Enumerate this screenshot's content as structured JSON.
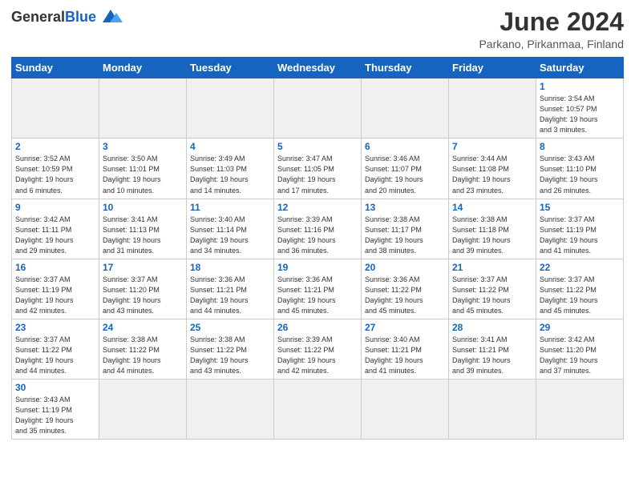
{
  "header": {
    "logo_general": "General",
    "logo_blue": "Blue",
    "month_title": "June 2024",
    "location": "Parkano, Pirkanmaa, Finland"
  },
  "weekdays": [
    "Sunday",
    "Monday",
    "Tuesday",
    "Wednesday",
    "Thursday",
    "Friday",
    "Saturday"
  ],
  "days": [
    {
      "date": "",
      "info": ""
    },
    {
      "date": "",
      "info": ""
    },
    {
      "date": "",
      "info": ""
    },
    {
      "date": "",
      "info": ""
    },
    {
      "date": "",
      "info": ""
    },
    {
      "date": "",
      "info": ""
    },
    {
      "date": "1",
      "info": "Sunrise: 3:54 AM\nSunset: 10:57 PM\nDaylight: 19 hours\nand 3 minutes."
    },
    {
      "date": "2",
      "info": "Sunrise: 3:52 AM\nSunset: 10:59 PM\nDaylight: 19 hours\nand 6 minutes."
    },
    {
      "date": "3",
      "info": "Sunrise: 3:50 AM\nSunset: 11:01 PM\nDaylight: 19 hours\nand 10 minutes."
    },
    {
      "date": "4",
      "info": "Sunrise: 3:49 AM\nSunset: 11:03 PM\nDaylight: 19 hours\nand 14 minutes."
    },
    {
      "date": "5",
      "info": "Sunrise: 3:47 AM\nSunset: 11:05 PM\nDaylight: 19 hours\nand 17 minutes."
    },
    {
      "date": "6",
      "info": "Sunrise: 3:46 AM\nSunset: 11:07 PM\nDaylight: 19 hours\nand 20 minutes."
    },
    {
      "date": "7",
      "info": "Sunrise: 3:44 AM\nSunset: 11:08 PM\nDaylight: 19 hours\nand 23 minutes."
    },
    {
      "date": "8",
      "info": "Sunrise: 3:43 AM\nSunset: 11:10 PM\nDaylight: 19 hours\nand 26 minutes."
    },
    {
      "date": "9",
      "info": "Sunrise: 3:42 AM\nSunset: 11:11 PM\nDaylight: 19 hours\nand 29 minutes."
    },
    {
      "date": "10",
      "info": "Sunrise: 3:41 AM\nSunset: 11:13 PM\nDaylight: 19 hours\nand 31 minutes."
    },
    {
      "date": "11",
      "info": "Sunrise: 3:40 AM\nSunset: 11:14 PM\nDaylight: 19 hours\nand 34 minutes."
    },
    {
      "date": "12",
      "info": "Sunrise: 3:39 AM\nSunset: 11:16 PM\nDaylight: 19 hours\nand 36 minutes."
    },
    {
      "date": "13",
      "info": "Sunrise: 3:38 AM\nSunset: 11:17 PM\nDaylight: 19 hours\nand 38 minutes."
    },
    {
      "date": "14",
      "info": "Sunrise: 3:38 AM\nSunset: 11:18 PM\nDaylight: 19 hours\nand 39 minutes."
    },
    {
      "date": "15",
      "info": "Sunrise: 3:37 AM\nSunset: 11:19 PM\nDaylight: 19 hours\nand 41 minutes."
    },
    {
      "date": "16",
      "info": "Sunrise: 3:37 AM\nSunset: 11:19 PM\nDaylight: 19 hours\nand 42 minutes."
    },
    {
      "date": "17",
      "info": "Sunrise: 3:37 AM\nSunset: 11:20 PM\nDaylight: 19 hours\nand 43 minutes."
    },
    {
      "date": "18",
      "info": "Sunrise: 3:36 AM\nSunset: 11:21 PM\nDaylight: 19 hours\nand 44 minutes."
    },
    {
      "date": "19",
      "info": "Sunrise: 3:36 AM\nSunset: 11:21 PM\nDaylight: 19 hours\nand 45 minutes."
    },
    {
      "date": "20",
      "info": "Sunrise: 3:36 AM\nSunset: 11:22 PM\nDaylight: 19 hours\nand 45 minutes."
    },
    {
      "date": "21",
      "info": "Sunrise: 3:37 AM\nSunset: 11:22 PM\nDaylight: 19 hours\nand 45 minutes."
    },
    {
      "date": "22",
      "info": "Sunrise: 3:37 AM\nSunset: 11:22 PM\nDaylight: 19 hours\nand 45 minutes."
    },
    {
      "date": "23",
      "info": "Sunrise: 3:37 AM\nSunset: 11:22 PM\nDaylight: 19 hours\nand 44 minutes."
    },
    {
      "date": "24",
      "info": "Sunrise: 3:38 AM\nSunset: 11:22 PM\nDaylight: 19 hours\nand 44 minutes."
    },
    {
      "date": "25",
      "info": "Sunrise: 3:38 AM\nSunset: 11:22 PM\nDaylight: 19 hours\nand 43 minutes."
    },
    {
      "date": "26",
      "info": "Sunrise: 3:39 AM\nSunset: 11:22 PM\nDaylight: 19 hours\nand 42 minutes."
    },
    {
      "date": "27",
      "info": "Sunrise: 3:40 AM\nSunset: 11:21 PM\nDaylight: 19 hours\nand 41 minutes."
    },
    {
      "date": "28",
      "info": "Sunrise: 3:41 AM\nSunset: 11:21 PM\nDaylight: 19 hours\nand 39 minutes."
    },
    {
      "date": "29",
      "info": "Sunrise: 3:42 AM\nSunset: 11:20 PM\nDaylight: 19 hours\nand 37 minutes."
    },
    {
      "date": "30",
      "info": "Sunrise: 3:43 AM\nSunset: 11:19 PM\nDaylight: 19 hours\nand 35 minutes."
    },
    {
      "date": "",
      "info": ""
    },
    {
      "date": "",
      "info": ""
    },
    {
      "date": "",
      "info": ""
    },
    {
      "date": "",
      "info": ""
    },
    {
      "date": "",
      "info": ""
    },
    {
      "date": "",
      "info": ""
    }
  ]
}
